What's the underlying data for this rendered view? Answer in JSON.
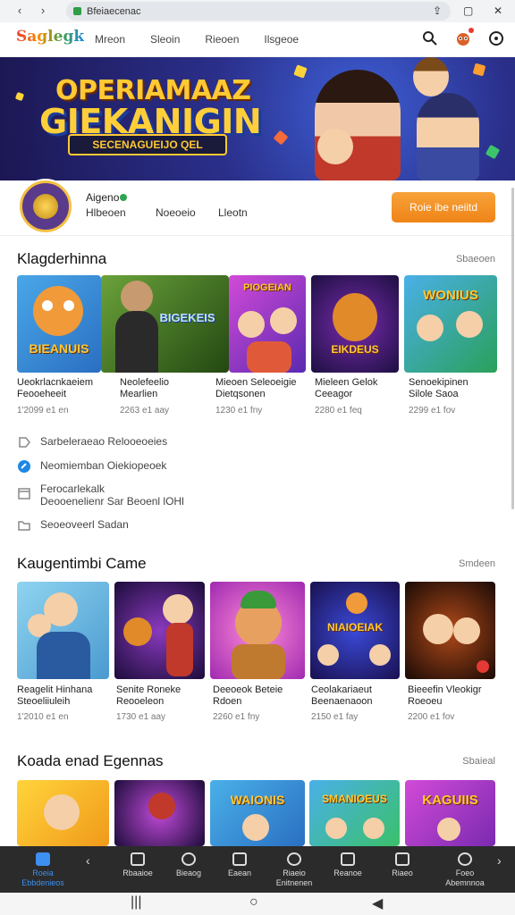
{
  "browser": {
    "url": "Bfeiaecenac",
    "back": "‹",
    "forward": "›"
  },
  "header": {
    "logo": "Saglegk",
    "nav": [
      "Mreon",
      "Sleoin",
      "Rieoen",
      "Ilsgeoe"
    ]
  },
  "banner": {
    "line1": "OPERIAMAAZ",
    "line2": "GIEKANIGIN",
    "line3": "SECENAGUEIJO QEL"
  },
  "profile": {
    "name": "Aigeno",
    "stats": [
      "Hlbeoen",
      "Noeoeio",
      "Lleotn"
    ],
    "action": "Roie ibe neiitd"
  },
  "section1": {
    "title": "Klagderhinna",
    "more": "Sbaeoen",
    "cards": [
      {
        "title1": "Ueokrlacnkaeiem",
        "title2": "Feooeheeit",
        "meta": "1'2099 e1 en",
        "label": "BIEANUIS"
      },
      {
        "title1": "Neolefeelio",
        "title2": "Mearlien",
        "meta": "2263 e1 aay",
        "label": "BIGEKEIS"
      },
      {
        "title1": "Mieoen Seleoeigie",
        "title2": "Dietqsonen",
        "meta": "1230 e1 fny",
        "label": "PIOGEIAN"
      },
      {
        "title1": "Mieleen Gelok",
        "title2": "Ceeagor",
        "meta": "2280 e1 feq",
        "label": "EIKDEUS"
      },
      {
        "title1": "Senoekipinen",
        "title2": "Silole Saoa",
        "meta": "2299 e1 fov",
        "label": "WONIUS"
      }
    ]
  },
  "info": [
    {
      "text": "Sarbeleraeao Relooeoeies"
    },
    {
      "text": "Neomiemban Oiekiopeoek"
    },
    {
      "text": "Ferocarlekalk",
      "text2": "Deooenelienr Sar Beoenl lOHl"
    },
    {
      "text": "Seoeoveerl Sadan"
    }
  ],
  "section2": {
    "title": "Kaugentimbi Came",
    "more": "Smdeen",
    "cards": [
      {
        "title1": "Reagelit Hinhana",
        "title2": "Steoeliiuleih",
        "meta": "1'2010 e1 en"
      },
      {
        "title1": "Senite Roneke",
        "title2": "Reooeleon",
        "meta": "1730 e1 aay"
      },
      {
        "title1": "Deeoeok Beteie",
        "title2": "Rdoen",
        "meta": "2260 e1 fny",
        "label": ""
      },
      {
        "title1": "Ceolakariaeut",
        "title2": "Beenaenaoon",
        "meta": "2150 e1 fay",
        "label": "NIAIOEIAK"
      },
      {
        "title1": "Bieeefin Vleokigr",
        "title2": "Roeoeu",
        "meta": "2200 e1 fov"
      }
    ]
  },
  "section3": {
    "title": "Koada enad Egennas",
    "more": "Sbaieal",
    "cards": [
      {
        "label": ""
      },
      {
        "label": ""
      },
      {
        "label": "WAIONIS"
      },
      {
        "label": "SMANIOEUS"
      },
      {
        "label": "KAGUIIS"
      }
    ]
  },
  "tabs": [
    {
      "label": "Roeia\nEbbdenieos"
    },
    {
      "label": "Rbaaioe"
    },
    {
      "label": "Bieaog"
    },
    {
      "label": "Eaean"
    },
    {
      "label": "Riaeio\nEnitnenen"
    },
    {
      "label": "Reanoe"
    },
    {
      "label": "Riaeo"
    },
    {
      "label": "Foeo\nAbemnnoa"
    }
  ],
  "colors": {
    "accent": "#ef8416",
    "tab_active": "#3d8ff0",
    "tabbar_bg": "#2b2b2b"
  }
}
